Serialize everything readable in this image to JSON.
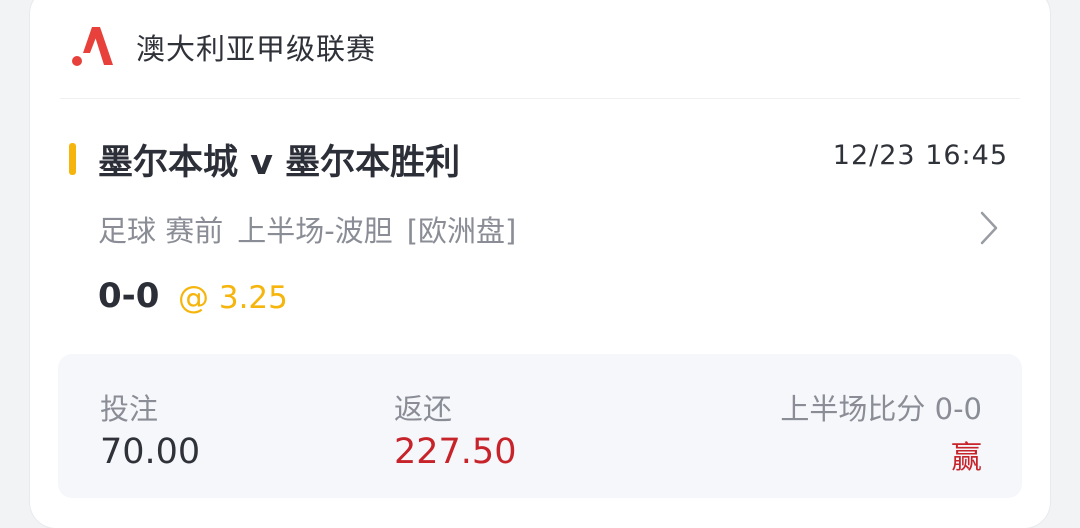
{
  "league": {
    "name": "澳大利亚甲级联赛"
  },
  "match": {
    "title": "墨尔本城 v 墨尔本胜利",
    "datetime": "12/23 16:45"
  },
  "bet": {
    "sport_status": "足球 赛前",
    "market": "上半场-波胆",
    "odds_type": "[欧洲盘]",
    "selection": "0-0",
    "odds": "@ 3.25"
  },
  "summary": {
    "stake_label": "投注",
    "stake_value": "70.00",
    "return_label": "返还",
    "return_value": "227.50",
    "score_label": "上半场比分 0-0",
    "result": "赢"
  },
  "colors": {
    "accent": "#f5b50d",
    "brand_red": "#e8403a",
    "win_red": "#c7232a"
  },
  "icons": {
    "logo": "brand-logo-icon",
    "chevron": "chevron-right-icon"
  }
}
